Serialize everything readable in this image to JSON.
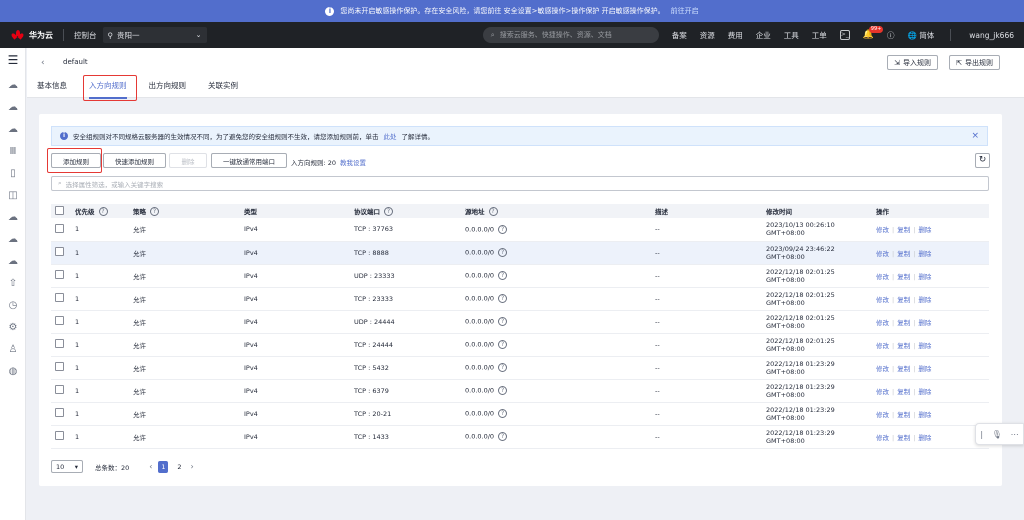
{
  "notice": {
    "text": "您尚未开启敏感操作保护。存在安全风险，请您前往 安全设置>敏感操作>操作保护 开启敏感操作保护。",
    "link": "前往开启"
  },
  "topnav": {
    "brand": "华为云",
    "console": "控制台",
    "region": "贵阳一",
    "search_placeholder": "搜索云服务、快捷操作、资源、文档",
    "links": [
      "备案",
      "资源",
      "费用",
      "企业",
      "工具",
      "工单"
    ],
    "notification_badge": "99+",
    "language": "简体",
    "user": "wang_jk666"
  },
  "header": {
    "breadcrumb": "default",
    "import_button": "导入规则",
    "export_button": "导出规则",
    "tabs": [
      "基本信息",
      "入方向规则",
      "出方向规则",
      "关联实例"
    ],
    "active_tab_index": 1
  },
  "alert": {
    "text": "安全组规则对不同规格云服务器的生效情况不同，为了避免您的安全组规则不生效，请您添加规则前，单击",
    "link": "此处",
    "tail": "了解详情。"
  },
  "toolbar": {
    "add_rule": "添加规则",
    "quick_add": "快速添加规则",
    "delete": "删除",
    "open_common_ports": "一键放通常用端口",
    "rule_count_label": "入方向规则: 20",
    "tutorial_link": "教我设置",
    "filter_placeholder": "选择属性筛选，或输入关键字搜索"
  },
  "table": {
    "columns": [
      "优先级",
      "策略",
      "类型",
      "协议端口",
      "源地址",
      "描述",
      "修改时间",
      "操作"
    ],
    "action_labels": [
      "修改",
      "复制",
      "删除"
    ],
    "rows": [
      {
        "priority": "1",
        "policy": "允许",
        "type": "IPv4",
        "port": "TCP : 37763",
        "source": "0.0.0.0/0",
        "desc": "--",
        "time": "2023/10/13 00:26:10 GMT+08:00"
      },
      {
        "priority": "1",
        "policy": "允许",
        "type": "IPv4",
        "port": "TCP : 8888",
        "source": "0.0.0.0/0",
        "desc": "--",
        "time": "2023/09/24 23:46:22 GMT+08:00"
      },
      {
        "priority": "1",
        "policy": "允许",
        "type": "IPv4",
        "port": "UDP : 23333",
        "source": "0.0.0.0/0",
        "desc": "--",
        "time": "2022/12/18 02:01:25 GMT+08:00"
      },
      {
        "priority": "1",
        "policy": "允许",
        "type": "IPv4",
        "port": "TCP : 23333",
        "source": "0.0.0.0/0",
        "desc": "--",
        "time": "2022/12/18 02:01:25 GMT+08:00"
      },
      {
        "priority": "1",
        "policy": "允许",
        "type": "IPv4",
        "port": "UDP : 24444",
        "source": "0.0.0.0/0",
        "desc": "--",
        "time": "2022/12/18 02:01:25 GMT+08:00"
      },
      {
        "priority": "1",
        "policy": "允许",
        "type": "IPv4",
        "port": "TCP : 24444",
        "source": "0.0.0.0/0",
        "desc": "--",
        "time": "2022/12/18 02:01:25 GMT+08:00"
      },
      {
        "priority": "1",
        "policy": "允许",
        "type": "IPv4",
        "port": "TCP : 5432",
        "source": "0.0.0.0/0",
        "desc": "--",
        "time": "2022/12/18 01:23:29 GMT+08:00"
      },
      {
        "priority": "1",
        "policy": "允许",
        "type": "IPv4",
        "port": "TCP : 6379",
        "source": "0.0.0.0/0",
        "desc": "--",
        "time": "2022/12/18 01:23:29 GMT+08:00"
      },
      {
        "priority": "1",
        "policy": "允许",
        "type": "IPv4",
        "port": "TCP : 20-21",
        "source": "0.0.0.0/0",
        "desc": "--",
        "time": "2022/12/18 01:23:29 GMT+08:00"
      },
      {
        "priority": "1",
        "policy": "允许",
        "type": "IPv4",
        "port": "TCP : 1433",
        "source": "0.0.0.0/0",
        "desc": "--",
        "time": "2022/12/18 01:23:29 GMT+08:00"
      }
    ]
  },
  "pagination": {
    "page_size": "10",
    "total": "总条数：20",
    "pages": [
      "1",
      "2"
    ],
    "current_page": "1"
  },
  "colors": {
    "accent": "#526ecc",
    "highlight_box": "#e53935",
    "nav_bg": "#1f2226"
  }
}
